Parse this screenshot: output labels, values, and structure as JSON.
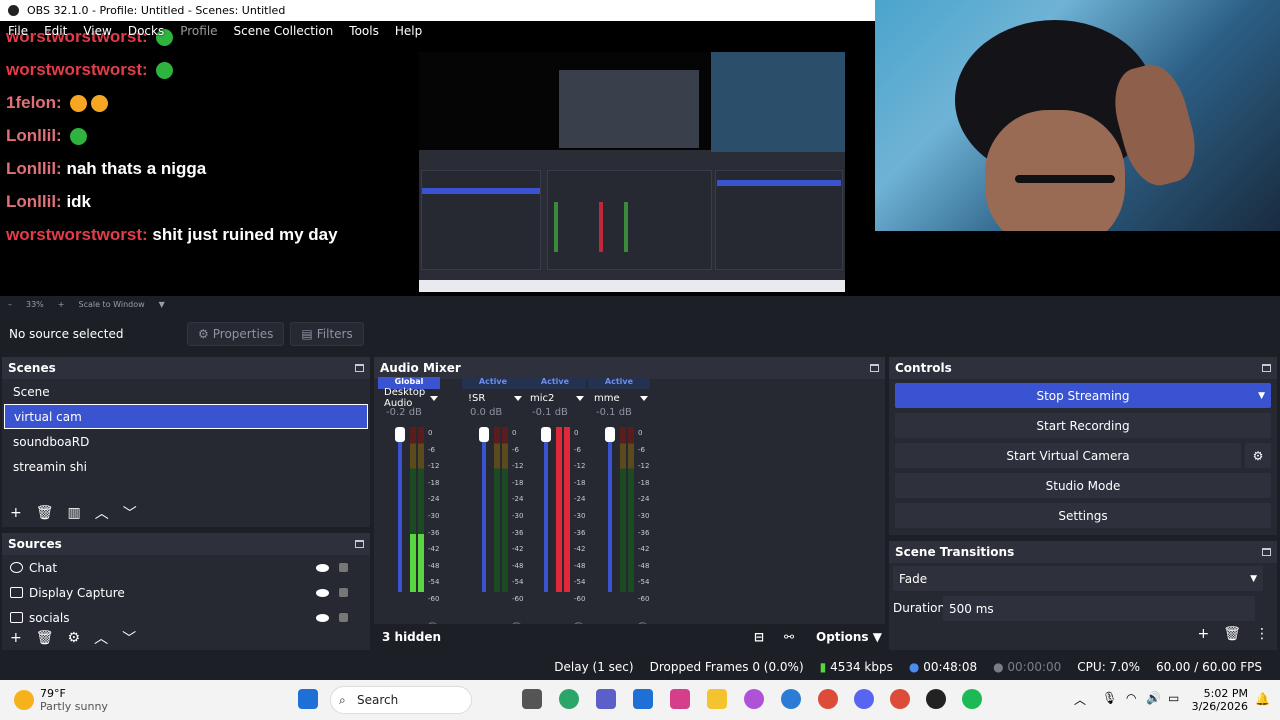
{
  "window": {
    "title": "OBS 32.1.0 - Profile: Untitled - Scenes: Untitled"
  },
  "menu": [
    "File",
    "Edit",
    "View",
    "Docks",
    "Profile",
    "Scene Collection",
    "Tools",
    "Help"
  ],
  "chat": [
    {
      "user": "worstworstworst:",
      "msg": "",
      "emote": "green",
      "userColor": "red"
    },
    {
      "user": "1felon:",
      "msg": "",
      "emote": "orange2",
      "userColor": "pink"
    },
    {
      "user": "Lonllil:",
      "msg": "",
      "emote": "green",
      "userColor": "pink"
    },
    {
      "user": "Lonllil:",
      "msg": "nah thats a nigga",
      "emote": "",
      "userColor": "pink"
    },
    {
      "user": "Lonllil:",
      "msg": "idk",
      "emote": "",
      "userColor": "pink"
    },
    {
      "user": "worstworstworst:",
      "msg": "shit just ruined my day",
      "emote": "",
      "userColor": "red"
    }
  ],
  "zoom": {
    "minus": "–",
    "value": "33%",
    "plus": "+",
    "mode": "Scale to Window"
  },
  "sourcebar": {
    "status": "No source selected",
    "properties": "Properties",
    "filters": "Filters"
  },
  "scenes": {
    "title": "Scenes",
    "items": [
      "Scene",
      "virtual cam",
      "soundboaRD",
      "streamin shi"
    ],
    "selected": 1
  },
  "sources": {
    "title": "Sources",
    "items": [
      {
        "name": "Chat",
        "icon": "globe-icon"
      },
      {
        "name": "Display Capture",
        "icon": "monitor-icon"
      },
      {
        "name": "socials",
        "icon": "image-icon"
      }
    ]
  },
  "mixer": {
    "title": "Audio Mixer",
    "channels": [
      {
        "status": "Global",
        "name": "Desktop Audio",
        "db": "-0.2 dB",
        "level": 0.35,
        "red": false
      },
      {
        "status": "Active",
        "name": "!SR",
        "db": "0.0 dB",
        "level": 0.0,
        "red": false
      },
      {
        "status": "Active",
        "name": "mic2",
        "db": "-0.1 dB",
        "level": 1.0,
        "red": true
      },
      {
        "status": "Active",
        "name": "mme",
        "db": "-0.1 dB",
        "level": 0.0,
        "red": false
      }
    ],
    "scale": [
      "0",
      "-6",
      "-12",
      "-18",
      "-24",
      "-30",
      "-36",
      "-42",
      "-48",
      "-54",
      "-60"
    ],
    "hidden": "3 hidden",
    "options": "Options"
  },
  "controls": {
    "title": "Controls",
    "buttons": [
      "Stop Streaming",
      "Start Recording",
      "Start Virtual Camera",
      "Studio Mode",
      "Settings"
    ]
  },
  "transitions": {
    "title": "Scene Transitions",
    "selected": "Fade",
    "duration_label": "Duration",
    "duration_value": "500 ms"
  },
  "status": {
    "delay": "Delay (1 sec)",
    "dropped": "Dropped Frames 0 (0.0%)",
    "bitrate": "4534 kbps",
    "stream_time": "00:48:08",
    "rec_time": "00:00:00",
    "cpu": "CPU: 7.0%",
    "fps": "60.00 / 60.00 FPS"
  },
  "taskbar": {
    "temp": "79°F",
    "weather": "Partly sunny",
    "search": "Search",
    "time": "5:02 PM",
    "date": "3/26/2026"
  },
  "colors": {
    "accent": "#3a53d0",
    "panel": "#262932",
    "bg": "#1d1f26"
  }
}
